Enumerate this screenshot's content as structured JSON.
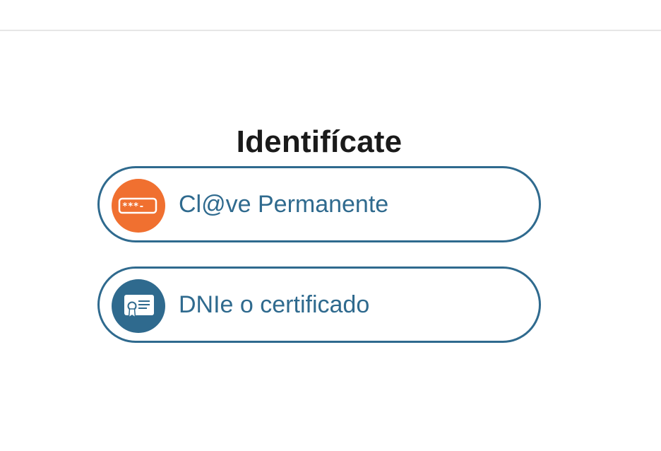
{
  "header": {},
  "title": "Identifícate",
  "options": [
    {
      "label": "Cl@ve Permanente",
      "icon": "password-field-icon",
      "icon_glyph": "***-",
      "icon_color": "#f07030"
    },
    {
      "label": "DNIe o certificado",
      "icon": "certificate-icon",
      "icon_color": "#2f6a8e"
    }
  ],
  "colors": {
    "accent": "#2f6a8e",
    "orange": "#f07030",
    "title": "#1a1a1a",
    "divider": "#e6e6e6"
  }
}
